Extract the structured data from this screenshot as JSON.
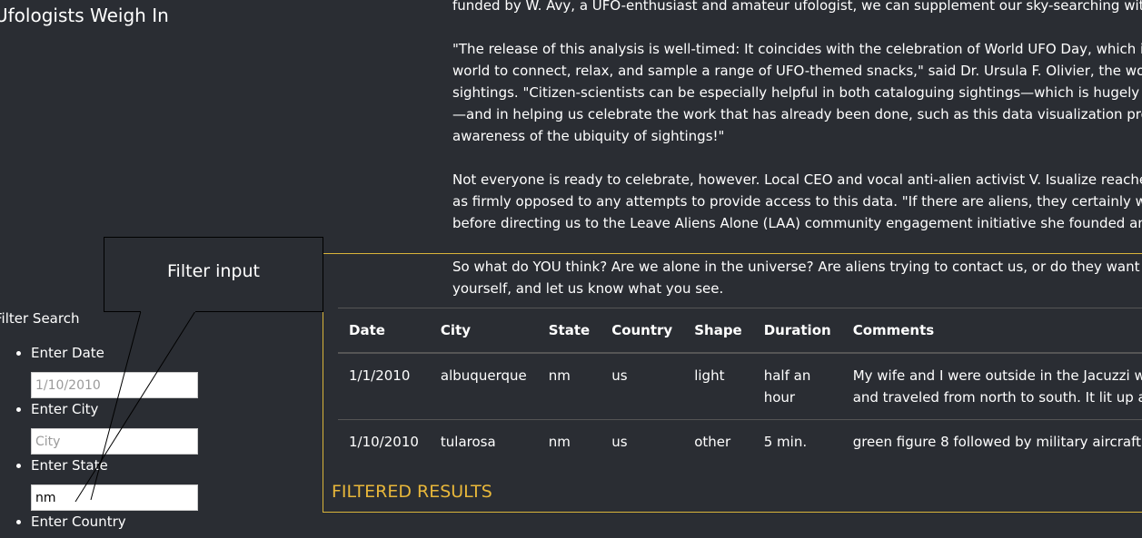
{
  "sidebar": {
    "heading": "Ufologists Weigh In",
    "filter_title": "Filter Search",
    "filters": [
      {
        "label": "Enter Date",
        "value": "",
        "placeholder": "1/10/2010"
      },
      {
        "label": "Enter City",
        "value": "",
        "placeholder": "City"
      },
      {
        "label": "Enter State",
        "value": "nm",
        "placeholder": ""
      },
      {
        "label": "Enter Country",
        "value": "",
        "placeholder": ""
      }
    ]
  },
  "callout": {
    "label": "Filter input"
  },
  "article": {
    "paragraphs": [
      "funded by W. Avy, a UFO-enthusiast and amateur ufologist, we can supplement our sky-searching with data",
      "\"The release of this analysis is well-timed: It coincides with the celebration of World UFO Day, which is a mom",
      "world to connect, relax, and sample a range of UFO-themed snacks,\" said Dr. Ursula F. Olivier, the world's pre",
      "sightings. \"Citizen-scientists can be especially helpful in both cataloguing sightings—which is hugely helpful",
      "—and in helping us celebrate the work that has already been done, such as this data visualization project, wh",
      "awareness of the ubiquity of sightings!\"",
      "Not everyone is ready to celebrate, however. Local CEO and vocal anti-alien activist V. Isualize reached out to",
      "as firmly opposed to any attempts to provide access to this data. \"If there are aliens, they certainly would like",
      "before directing us to the Leave Aliens Alone (LAA) community engagement initiative she founded and funds",
      "So what do YOU think? Are we alone in the universe? Are aliens trying to contact us, or do they want to be le",
      "yourself, and let us know what you see."
    ]
  },
  "results": {
    "label": "FILTERED RESULTS",
    "columns": [
      "Date",
      "City",
      "State",
      "Country",
      "Shape",
      "Duration",
      "Comments"
    ],
    "rows": [
      {
        "date": "1/1/2010",
        "city": "albuquerque",
        "state": "nm",
        "country": "us",
        "shape": "light",
        "duration_1": "half an",
        "duration_2": "hour",
        "comments_1": "My wife and I were outside in the Jacuzzi when sh",
        "comments_2": "and traveled from north to south. It lit up again wi"
      },
      {
        "date": "1/10/2010",
        "city": "tularosa",
        "state": "nm",
        "country": "us",
        "shape": "other",
        "duration_1": "5 min.",
        "duration_2": "",
        "comments_1": "green figure 8 followed by military aircraft",
        "comments_2": ""
      }
    ]
  },
  "colors": {
    "background": "#2a2d33",
    "accent": "#e8b73a",
    "box_border": "#d9b43a"
  }
}
